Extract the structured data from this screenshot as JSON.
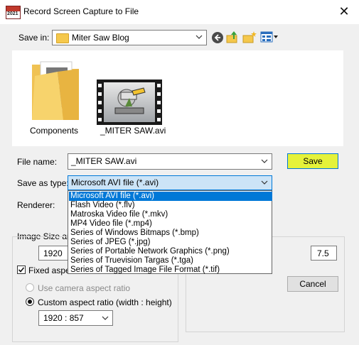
{
  "window": {
    "title": "Record Screen Capture to File",
    "app_icon_text": "2021"
  },
  "save_in": {
    "label": "Save in:",
    "value": "Miter Saw Blog",
    "icons": [
      "back-icon",
      "up-folder-icon",
      "new-folder-icon",
      "view-menu-icon"
    ]
  },
  "files": [
    {
      "name": "Components",
      "type": "folder"
    },
    {
      "name": "_MITER SAW.avi",
      "type": "video"
    }
  ],
  "file_name": {
    "label": "File name:",
    "value": "_MITER SAW.avi"
  },
  "save_as_type": {
    "label": "Save as type:",
    "value": "Microsoft AVI file (*.avi)",
    "options": [
      "Microsoft AVI file (*.avi)",
      "Flash Video (*.flv)",
      "Matroska Video file (*.mkv)",
      "MP4 Video file (*.mp4)",
      "Series of Windows Bitmaps (*.bmp)",
      "Series of JPEG (*.jpg)",
      "Series of Portable Network Graphics (*.png)",
      "Series of Truevision Targas (*.tga)",
      "Series of Tagged Image File Format (*.tif)"
    ],
    "selected_index": 0
  },
  "renderer": {
    "label": "Renderer:"
  },
  "image_size": {
    "label": "Image Size and",
    "width_value": "1920",
    "fixed_aspect_label": "Fixed aspec",
    "fixed_aspect_checked": true,
    "camera_aspect_label": "Use camera aspect ratio",
    "custom_aspect_label": "Custom aspect ratio (width : height)",
    "aspect_value": "1920 : 857"
  },
  "frame_rate_value": "7.5",
  "buttons": {
    "save": "Save",
    "cancel": "Cancel"
  }
}
